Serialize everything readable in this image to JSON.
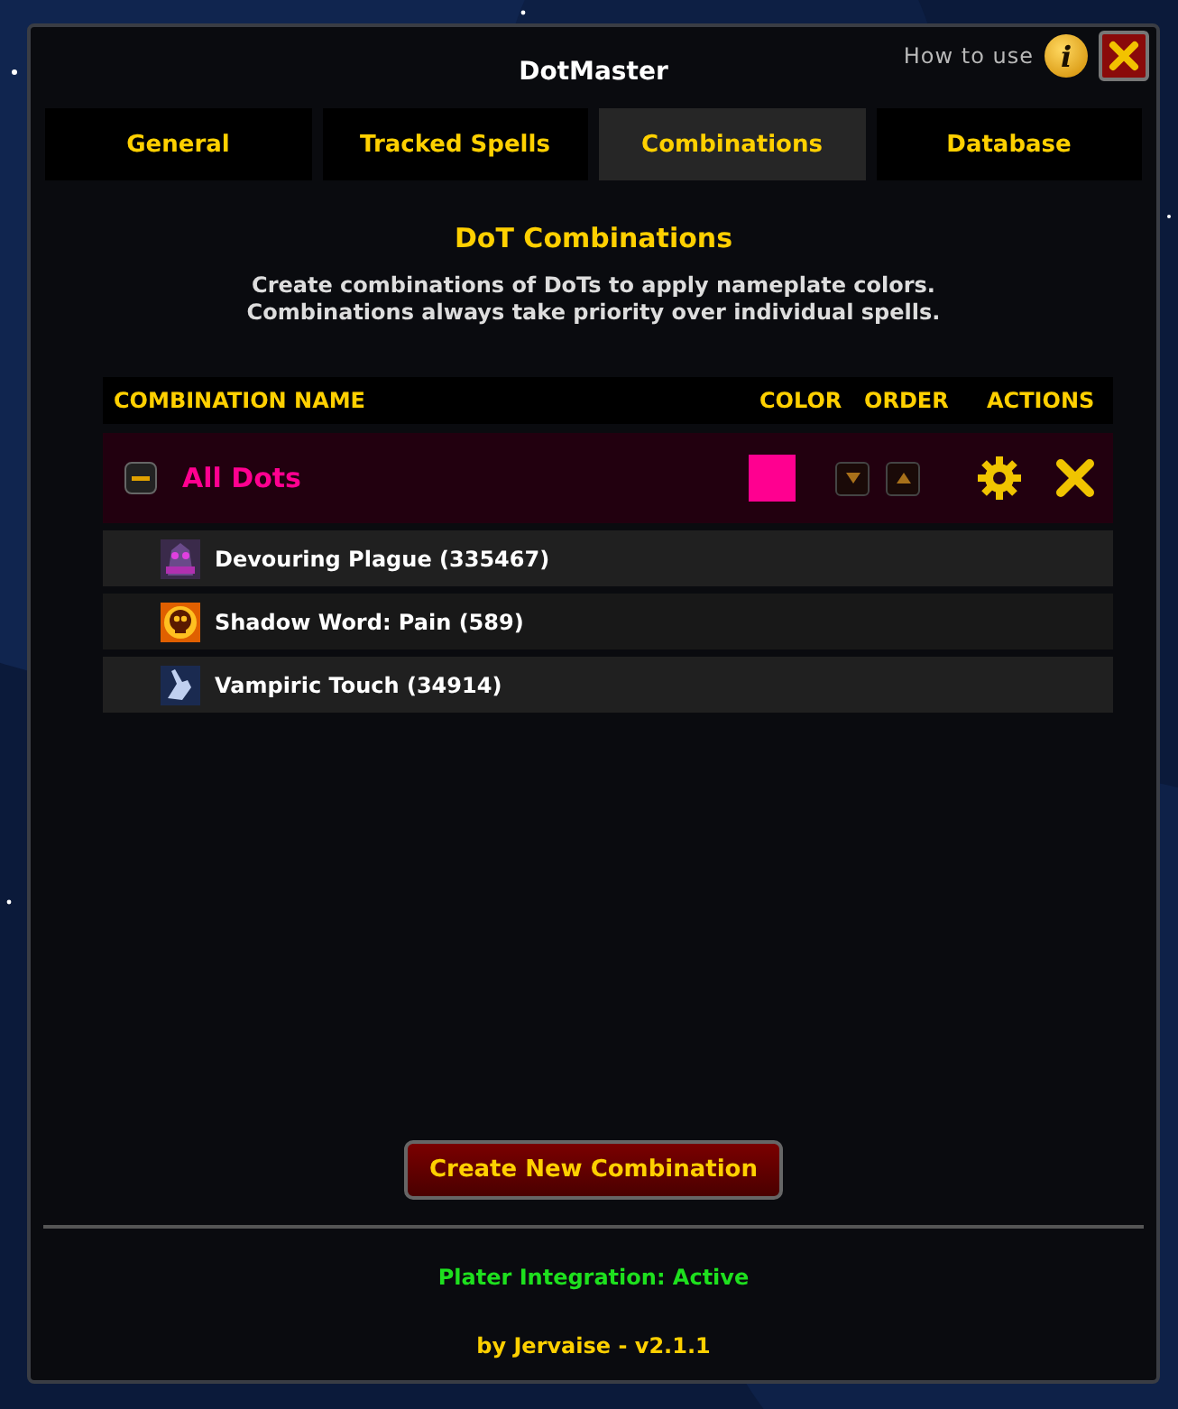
{
  "window": {
    "title": "DotMaster",
    "help_label": "How to use",
    "help_icon": "i"
  },
  "tabs": [
    {
      "label": "General",
      "selected": false
    },
    {
      "label": "Tracked Spells",
      "selected": false
    },
    {
      "label": "Combinations",
      "selected": true
    },
    {
      "label": "Database",
      "selected": false
    }
  ],
  "section": {
    "title": "DoT Combinations",
    "description": "Create combinations of DoTs to apply nameplate colors.\nCombinations always take priority over individual spells."
  },
  "table": {
    "columns": [
      "COMBINATION NAME",
      "COLOR",
      "ORDER",
      "ACTIONS"
    ],
    "combinations": [
      {
        "name": "All Dots",
        "color": "#ff0090",
        "expanded": true,
        "spells": [
          {
            "label": "Devouring Plague (335467)",
            "kind": "plague"
          },
          {
            "label": "Shadow Word: Pain (589)",
            "kind": "skull"
          },
          {
            "label": "Vampiric Touch (34914)",
            "kind": "hand"
          }
        ]
      }
    ]
  },
  "create_button": "Create New Combination",
  "status": "Plater Integration: Active",
  "footer": "by Jervaise - v2.1.1"
}
